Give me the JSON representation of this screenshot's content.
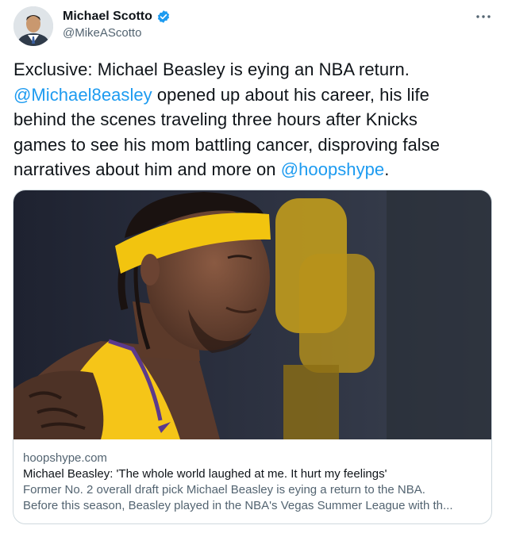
{
  "user": {
    "display_name": "Michael Scotto",
    "handle": "@MikeAScotto"
  },
  "tweet": {
    "line1": "Exclusive: Michael Beasley is eying an NBA return.",
    "mention1": "@Michael8easley",
    "line2_rest": " opened up about his career, his life",
    "line3": "behind the scenes traveling three hours after Knicks",
    "line4": "games to see his mom battling cancer, disproving false",
    "line5_start": "narratives about him and more on ",
    "mention2": "@hoopshype",
    "line5_end": "."
  },
  "card": {
    "domain": "hoopshype.com",
    "title": "Michael Beasley: 'The whole world laughed at me. It hurt my feelings'",
    "desc_line1": "Former No. 2 overall draft pick Michael Beasley is eying a return to the NBA.",
    "desc_line2": "Before this season, Beasley played in the NBA's Vegas Summer League with th..."
  },
  "colors": {
    "accent": "#1d9bf0",
    "secondary_text": "#536471",
    "headband": "#f2c40f",
    "jersey": "#f5c518"
  },
  "icons": {
    "verified": "verified-badge-icon",
    "more": "more-options-icon"
  }
}
